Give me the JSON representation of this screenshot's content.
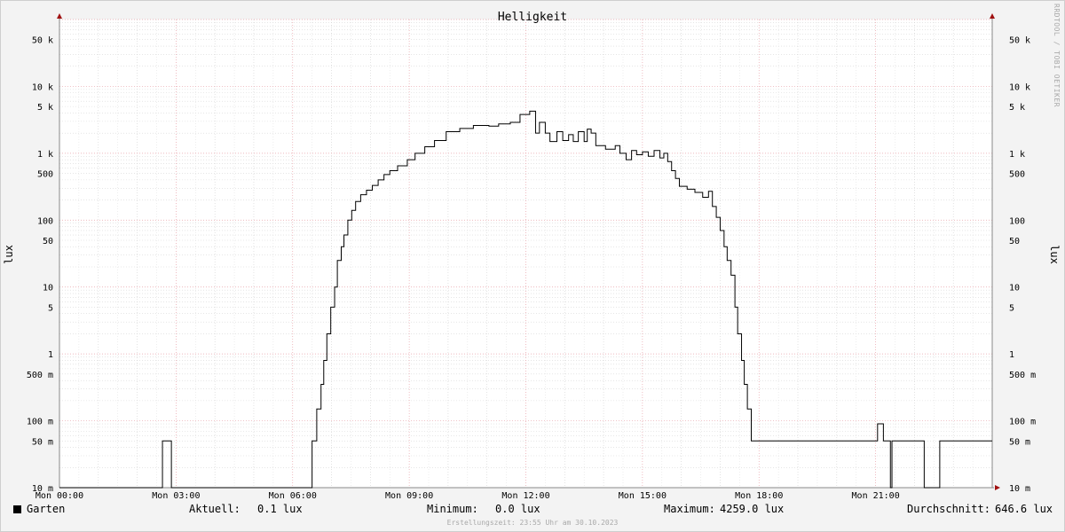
{
  "chart_data": {
    "type": "line",
    "title": "Helligkeit",
    "ylabel": "lux",
    "yscale": "log",
    "ylim": [
      0.01,
      100000
    ],
    "xlim": [
      0,
      24
    ],
    "grid": true,
    "x_tick_labels": [
      {
        "hour": 0,
        "label": "Mon 00:00"
      },
      {
        "hour": 3,
        "label": "Mon 03:00"
      },
      {
        "hour": 6,
        "label": "Mon 06:00"
      },
      {
        "hour": 9,
        "label": "Mon 09:00"
      },
      {
        "hour": 12,
        "label": "Mon 12:00"
      },
      {
        "hour": 15,
        "label": "Mon 15:00"
      },
      {
        "hour": 18,
        "label": "Mon 18:00"
      },
      {
        "hour": 21,
        "label": "Mon 21:00"
      }
    ],
    "y_tick_labels": [
      {
        "value": 0.01,
        "label": "10 m"
      },
      {
        "value": 0.05,
        "label": "50 m"
      },
      {
        "value": 0.1,
        "label": "100 m"
      },
      {
        "value": 0.5,
        "label": "500 m"
      },
      {
        "value": 1,
        "label": "1"
      },
      {
        "value": 5,
        "label": "5"
      },
      {
        "value": 10,
        "label": "10"
      },
      {
        "value": 50,
        "label": "50"
      },
      {
        "value": 100,
        "label": "100"
      },
      {
        "value": 500,
        "label": "500"
      },
      {
        "value": 1000,
        "label": "1 k"
      },
      {
        "value": 5000,
        "label": "5 k"
      },
      {
        "value": 10000,
        "label": "10 k"
      },
      {
        "value": 50000,
        "label": "50 k"
      }
    ],
    "series": [
      {
        "name": "Garten",
        "color": "#000000",
        "points": [
          [
            0,
            0.01
          ],
          [
            2.65,
            0.01
          ],
          [
            2.65,
            0.05
          ],
          [
            2.88,
            0.05
          ],
          [
            2.88,
            0.01
          ],
          [
            6.5,
            0.01
          ],
          [
            6.5,
            0.05
          ],
          [
            6.62,
            0.05
          ],
          [
            6.62,
            0.15
          ],
          [
            6.73,
            0.15
          ],
          [
            6.73,
            0.35
          ],
          [
            6.8,
            0.35
          ],
          [
            6.8,
            0.8
          ],
          [
            6.88,
            0.8
          ],
          [
            6.88,
            2
          ],
          [
            6.98,
            2
          ],
          [
            6.98,
            5
          ],
          [
            7.08,
            5
          ],
          [
            7.08,
            10
          ],
          [
            7.15,
            10
          ],
          [
            7.15,
            25
          ],
          [
            7.25,
            25
          ],
          [
            7.25,
            40
          ],
          [
            7.32,
            40
          ],
          [
            7.32,
            60
          ],
          [
            7.42,
            60
          ],
          [
            7.42,
            100
          ],
          [
            7.52,
            100
          ],
          [
            7.52,
            140
          ],
          [
            7.62,
            140
          ],
          [
            7.62,
            190
          ],
          [
            7.75,
            190
          ],
          [
            7.75,
            240
          ],
          [
            7.9,
            240
          ],
          [
            7.9,
            280
          ],
          [
            8.05,
            280
          ],
          [
            8.05,
            330
          ],
          [
            8.2,
            330
          ],
          [
            8.2,
            400
          ],
          [
            8.35,
            400
          ],
          [
            8.35,
            480
          ],
          [
            8.5,
            480
          ],
          [
            8.5,
            550
          ],
          [
            8.7,
            550
          ],
          [
            8.7,
            650
          ],
          [
            8.95,
            650
          ],
          [
            8.95,
            800
          ],
          [
            9.15,
            800
          ],
          [
            9.15,
            1000
          ],
          [
            9.4,
            1000
          ],
          [
            9.4,
            1250
          ],
          [
            9.65,
            1250
          ],
          [
            9.65,
            1550
          ],
          [
            9.95,
            1550
          ],
          [
            9.95,
            2100
          ],
          [
            10.3,
            2100
          ],
          [
            10.3,
            2350
          ],
          [
            10.65,
            2350
          ],
          [
            10.65,
            2600
          ],
          [
            11.05,
            2600
          ],
          [
            11.05,
            2550
          ],
          [
            11.3,
            2550
          ],
          [
            11.3,
            2750
          ],
          [
            11.6,
            2750
          ],
          [
            11.6,
            2900
          ],
          [
            11.85,
            2900
          ],
          [
            11.85,
            3800
          ],
          [
            12.1,
            3800
          ],
          [
            12.1,
            4259
          ],
          [
            12.25,
            4259
          ],
          [
            12.25,
            2000
          ],
          [
            12.35,
            2000
          ],
          [
            12.35,
            2900
          ],
          [
            12.5,
            2900
          ],
          [
            12.5,
            2000
          ],
          [
            12.62,
            2000
          ],
          [
            12.62,
            1500
          ],
          [
            12.8,
            1500
          ],
          [
            12.8,
            2100
          ],
          [
            12.95,
            2100
          ],
          [
            12.95,
            1550
          ],
          [
            13.1,
            1550
          ],
          [
            13.1,
            1900
          ],
          [
            13.22,
            1900
          ],
          [
            13.22,
            1500
          ],
          [
            13.35,
            1500
          ],
          [
            13.35,
            2100
          ],
          [
            13.5,
            2100
          ],
          [
            13.5,
            1500
          ],
          [
            13.58,
            1500
          ],
          [
            13.58,
            2300
          ],
          [
            13.68,
            2300
          ],
          [
            13.68,
            2000
          ],
          [
            13.8,
            2000
          ],
          [
            13.8,
            1300
          ],
          [
            14.05,
            1300
          ],
          [
            14.05,
            1150
          ],
          [
            14.3,
            1150
          ],
          [
            14.3,
            1300
          ],
          [
            14.42,
            1300
          ],
          [
            14.42,
            1000
          ],
          [
            14.58,
            1000
          ],
          [
            14.58,
            800
          ],
          [
            14.72,
            800
          ],
          [
            14.72,
            1100
          ],
          [
            14.85,
            1100
          ],
          [
            14.85,
            950
          ],
          [
            15.0,
            950
          ],
          [
            15.0,
            1050
          ],
          [
            15.15,
            1050
          ],
          [
            15.15,
            900
          ],
          [
            15.3,
            900
          ],
          [
            15.3,
            1100
          ],
          [
            15.45,
            1100
          ],
          [
            15.45,
            850
          ],
          [
            15.55,
            850
          ],
          [
            15.55,
            1000
          ],
          [
            15.65,
            1000
          ],
          [
            15.65,
            750
          ],
          [
            15.75,
            750
          ],
          [
            15.75,
            550
          ],
          [
            15.85,
            550
          ],
          [
            15.85,
            420
          ],
          [
            15.95,
            420
          ],
          [
            15.95,
            320
          ],
          [
            16.15,
            320
          ],
          [
            16.15,
            290
          ],
          [
            16.35,
            290
          ],
          [
            16.35,
            260
          ],
          [
            16.55,
            260
          ],
          [
            16.55,
            220
          ],
          [
            16.7,
            220
          ],
          [
            16.7,
            270
          ],
          [
            16.8,
            270
          ],
          [
            16.8,
            160
          ],
          [
            16.9,
            160
          ],
          [
            16.9,
            110
          ],
          [
            17.0,
            110
          ],
          [
            17.0,
            70
          ],
          [
            17.1,
            70
          ],
          [
            17.1,
            40
          ],
          [
            17.18,
            40
          ],
          [
            17.18,
            25
          ],
          [
            17.28,
            25
          ],
          [
            17.28,
            15
          ],
          [
            17.38,
            15
          ],
          [
            17.38,
            5
          ],
          [
            17.45,
            5
          ],
          [
            17.45,
            2
          ],
          [
            17.55,
            2
          ],
          [
            17.55,
            0.8
          ],
          [
            17.62,
            0.8
          ],
          [
            17.62,
            0.35
          ],
          [
            17.7,
            0.35
          ],
          [
            17.7,
            0.15
          ],
          [
            17.8,
            0.15
          ],
          [
            17.8,
            0.05
          ],
          [
            21.05,
            0.05
          ],
          [
            21.05,
            0.09
          ],
          [
            21.2,
            0.09
          ],
          [
            21.2,
            0.05
          ],
          [
            21.38,
            0.05
          ],
          [
            21.38,
            0.01
          ],
          [
            21.42,
            0.01
          ],
          [
            21.42,
            0.05
          ],
          [
            22.25,
            0.05
          ],
          [
            22.25,
            0.01
          ],
          [
            22.65,
            0.01
          ],
          [
            22.65,
            0.05
          ],
          [
            24,
            0.05
          ]
        ]
      }
    ]
  },
  "legend": {
    "name": "Garten",
    "current_label": "Aktuell:",
    "current_value": "0.1 lux",
    "min_label": "Minimum:",
    "min_value": "0.0 lux",
    "max_label": "Maximum:",
    "max_value": "4259.0 lux",
    "avg_label": "Durchschnitt:",
    "avg_value": "646.6 lux"
  },
  "footer": "Erstellungszeit: 23:55 Uhr am 30.10.2023",
  "watermark": "RRDTOOL / TOBI OETIKER"
}
